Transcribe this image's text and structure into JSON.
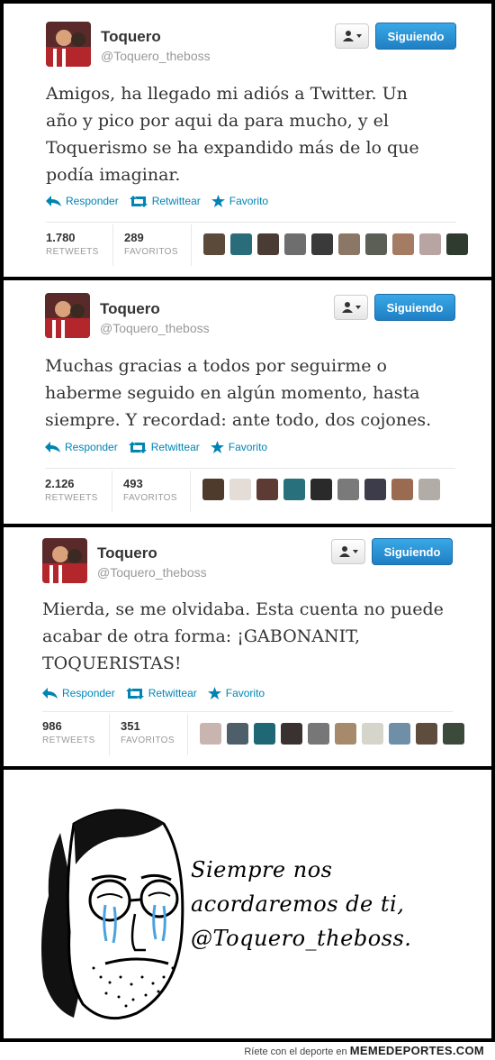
{
  "tweets": [
    {
      "name": "Toquero",
      "handle": "@Toquero_theboss",
      "follow_label": "Siguiendo",
      "text": "Amigos, ha llegado mi adiós a Twitter. Un año y pico por aqui da para mucho, y el Toquerismo se ha expandido más de lo que podía imaginar.",
      "reply": "Responder",
      "retweet": "Retwittear",
      "favorite": "Favorito",
      "retweets_count": "1.780",
      "retweets_label": "RETWEETS",
      "favorites_count": "289",
      "favorites_label": "FAVORITOS"
    },
    {
      "name": "Toquero",
      "handle": "@Toquero_theboss",
      "follow_label": "Siguiendo",
      "text": "Muchas gracias a todos por seguirme o haberme seguido en algún momento, hasta siempre. Y recordad: ante todo, dos cojones.",
      "reply": "Responder",
      "retweet": "Retwittear",
      "favorite": "Favorito",
      "retweets_count": "2.126",
      "retweets_label": "RETWEETS",
      "favorites_count": "493",
      "favorites_label": "FAVORITOS"
    },
    {
      "name": "Toquero",
      "handle": "@Toquero_theboss",
      "follow_label": "Siguiendo",
      "text": "Mierda, se me olvidaba. Esta cuenta no puede acabar de otra forma: ¡GABONANIT, TOQUERISTAS!",
      "reply": "Responder",
      "retweet": "Retwittear",
      "favorite": "Favorito",
      "retweets_count": "986",
      "retweets_label": "RETWEETS",
      "favorites_count": "351",
      "favorites_label": "FAVORITOS"
    }
  ],
  "meme": {
    "line1": "Siempre nos",
    "line2": "acordaremos de ti,",
    "line3": "@Toquero_theboss."
  },
  "footer": {
    "prefix": "Ríete con el deporte en",
    "brand": "MEMEDEPORTES.COM"
  },
  "colors": {
    "link": "#0084b4",
    "follow_button": "#2b8fd6"
  }
}
